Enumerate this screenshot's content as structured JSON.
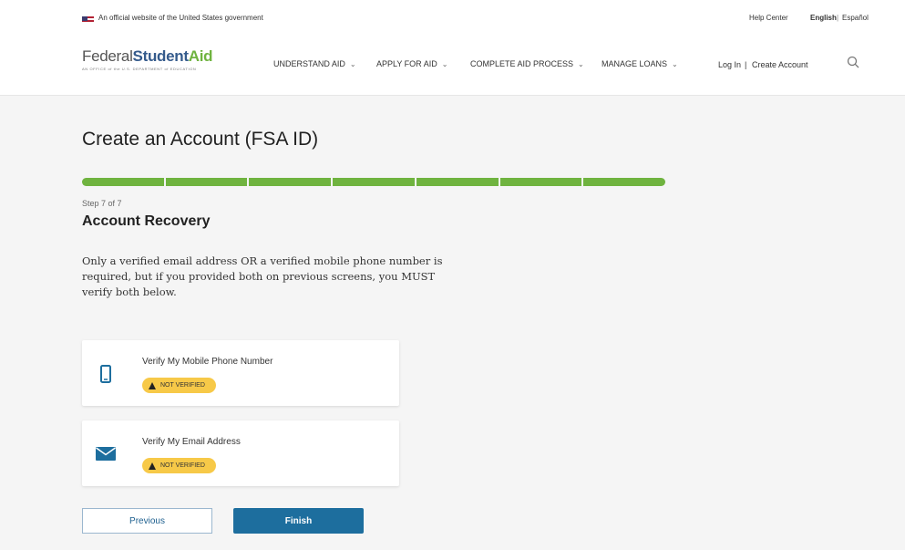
{
  "gov_banner": {
    "text": "An official website of the United States government",
    "help_center": "Help Center",
    "english": "English",
    "separator": "|",
    "espanol": "Español"
  },
  "header": {
    "logo_federal": "Federal",
    "logo_student": "Student",
    "logo_aid": "Aid",
    "logo_sub": "AN OFFICE of the U.S. DEPARTMENT of EDUCATION",
    "nav": [
      {
        "label": "UNDERSTAND AID"
      },
      {
        "label": "APPLY FOR AID"
      },
      {
        "label": "COMPLETE AID PROCESS"
      },
      {
        "label": "MANAGE LOANS"
      }
    ],
    "login": "Log In",
    "login_separator": "|",
    "create_account": "Create Account"
  },
  "main": {
    "title": "Create an Account (FSA ID)",
    "progress": {
      "completed_steps": 7,
      "total_steps": 7
    },
    "step_label": "Step 7 of 7",
    "subtitle": "Account Recovery",
    "description": "Only a verified email address OR a verified mobile phone number is required, but if you provided both on previous screens, you MUST verify both below.",
    "cards": [
      {
        "label": "Verify My Mobile Phone Number",
        "status": "NOT VERIFIED",
        "icon": "mobile-phone-icon"
      },
      {
        "label": "Verify My Email Address",
        "status": "NOT VERIFIED",
        "icon": "envelope-icon"
      }
    ],
    "buttons": {
      "previous": "Previous",
      "finish": "Finish"
    }
  },
  "colors": {
    "brand_blue": "#1d6e9e",
    "progress_green": "#6fb33f",
    "badge_yellow": "#f7c948",
    "icon_blue": "#1d6e9e"
  }
}
